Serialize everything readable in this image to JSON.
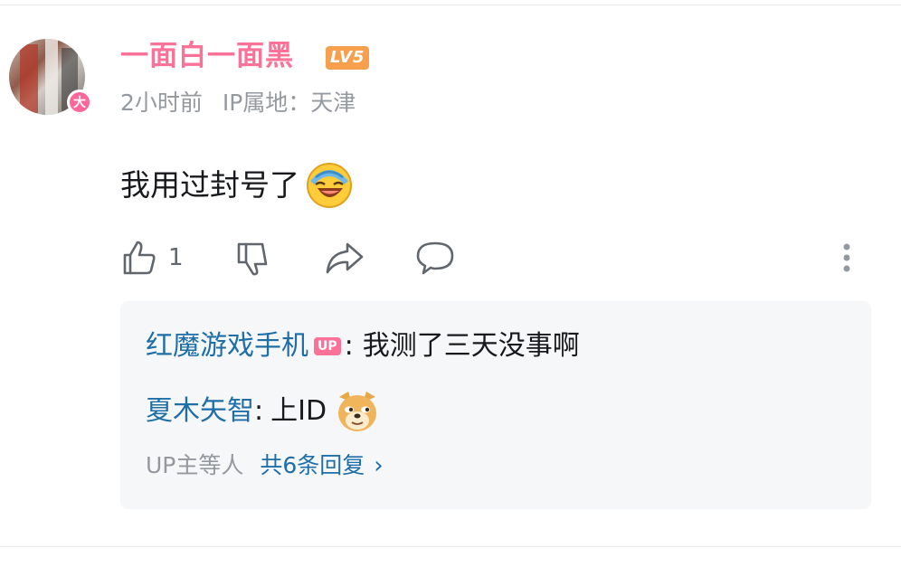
{
  "comment": {
    "username": "一面白一面黑",
    "level": "LV5",
    "vip_badge": "大",
    "time": "2小时前",
    "ip_location": "IP属地：天津",
    "text": "我用过封号了",
    "like_count": "1"
  },
  "replies": {
    "items": [
      {
        "name": "红魔游戏手机",
        "badge": "UP",
        "separator": ":",
        "text": "我测了三天没事啊"
      },
      {
        "name": "夏木矢智",
        "separator": ":",
        "text": "上ID"
      }
    ],
    "summary_who": "UP主等人",
    "summary_count": "共6条回复",
    "chevron": "›"
  },
  "colors": {
    "username": "#fb7299",
    "level_badge": "#f6a04d",
    "reply_name": "#1e6ea8",
    "meta_text": "#9499a0",
    "reply_box_bg": "#f6f7f8"
  },
  "icons": [
    "like-icon",
    "dislike-icon",
    "share-icon",
    "comment-icon",
    "more-icon",
    "laughing-emoji-icon",
    "doge-emoji-icon"
  ]
}
